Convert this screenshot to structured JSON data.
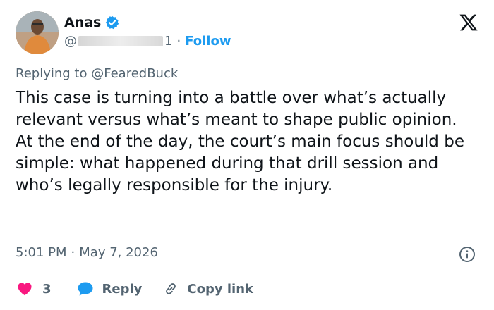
{
  "author": {
    "name": "Anas",
    "handle_prefix": "@",
    "handle_suffix": "1",
    "follow_label": "Follow",
    "separator": "·"
  },
  "reply_to": {
    "prefix": "Replying to",
    "handle": "@FearedBuck"
  },
  "tweet": {
    "paragraphs": [
      "This case is turning into a battle over what’s actually relevant versus what’s meant to shape public opinion.",
      "At the end of the day, the court’s main focus should be simple: what happened during that drill session and who’s legally responsible for the injury."
    ]
  },
  "meta": {
    "time": "5:01 PM",
    "separator": "·",
    "date": "May 7, 2026"
  },
  "actions": {
    "like_count": "3",
    "reply_label": "Reply",
    "copy_label": "Copy link"
  },
  "colors": {
    "accent": "#1d9bf0",
    "like": "#f91880",
    "text": "#0f1419",
    "muted": "#536471"
  }
}
